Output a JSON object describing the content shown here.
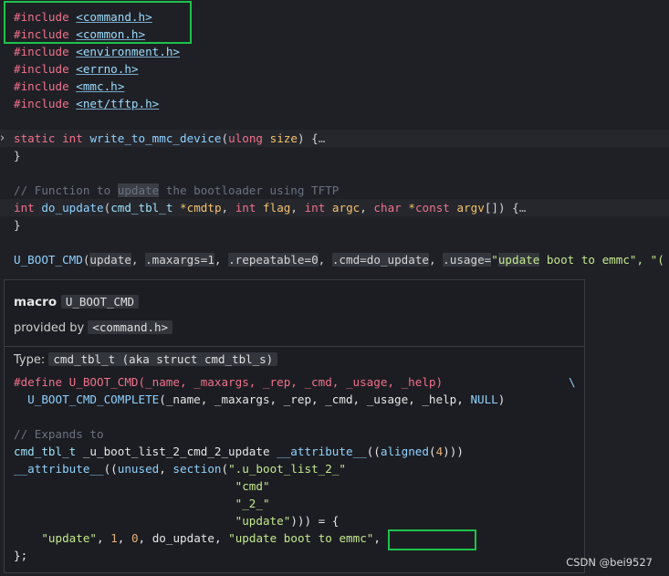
{
  "includes": [
    {
      "directive": "#include",
      "file": "<command.h>"
    },
    {
      "directive": "#include",
      "file": "<common.h>"
    },
    {
      "directive": "#include",
      "file": "<environment.h>"
    },
    {
      "directive": "#include",
      "file": "<errno.h>"
    },
    {
      "directive": "#include",
      "file": "<mmc.h>"
    },
    {
      "directive": "#include",
      "file": "<net/tftp.h>"
    }
  ],
  "write_fn": {
    "kw_static": "static",
    "kw_int": "int",
    "name": "write_to_mmc_device",
    "param_type": "ulong",
    "param": "size",
    "close": ") {",
    "ellipsis": "…",
    "brace": "}"
  },
  "comment": {
    "pre": "// Function to ",
    "hl": "update",
    "post": " the bootloader using TFTP"
  },
  "do_update_fn": {
    "ret": "int",
    "name": "do_update",
    "t1": "cmd_tbl_t",
    "p1": "*cmdtp",
    "t2": "int",
    "p2": "flag",
    "t3": "int",
    "p3": "argc",
    "t4": "char",
    "p4a": "*",
    "kw_const": "const",
    "p4": "argv",
    "tail": "[]) {",
    "ellipsis": "…",
    "brace": "}"
  },
  "uboot_cmd_line": {
    "macro": "U_BOOT_CMD",
    "a1": "update",
    "f1": ".maxargs=1",
    "f2": ".repeatable=0",
    "f3": ".cmd=do_update",
    "f4": ".usage=",
    "s1a": "\"",
    "s1b": "update",
    "s1c": " boot to emmc\"",
    "tail": ", \"("
  },
  "hover": {
    "kind": "macro",
    "name": "U_BOOT_CMD",
    "provided_label": "provided by",
    "provided_file": "<command.h>",
    "type_label": "Type:",
    "type_value": "cmd_tbl_t (aka struct cmd_tbl_s)",
    "def_line1": "#define U_BOOT_CMD(_name, _maxargs, _rep, _cmd, _usage, _help)",
    "def_backslash": "\\",
    "def_line2_macro": "U_BOOT_CMD_COMPLETE",
    "def_line2_args": "(_name, _maxargs, _rep, _cmd, _usage, _help, ",
    "def_line2_null": "NULL",
    "def_line2_end": ")",
    "expands_comment": "// Expands to",
    "exp1_type": "cmd_tbl_t",
    "exp1_var": " _u_boot_list_2_cmd_2_update ",
    "exp1_attr": "__attribute__",
    "exp1_open": "((",
    "exp1_aligned": "aligned",
    "exp1_num_open": "(",
    "exp1_num": "4",
    "exp1_close": ")))",
    "exp2_attr": "__attribute__",
    "exp2_open": "((",
    "exp2_unused": "unused",
    "exp2_sep": ", ",
    "exp2_section": "section",
    "exp2_paren": "(",
    "exp2_str": "\".u_boot_list_2_\"",
    "exp3_str": "\"cmd\"",
    "exp4_str": "\"_2_\"",
    "exp5_str": "\"update\"",
    "exp5_tail": "))) = {",
    "exp6_s1": "\"update\"",
    "exp6_n1": "1",
    "exp6_n2": "0",
    "exp6_fn": "do_update",
    "exp6_s2": "\"update boot to emmc\"",
    "exp6_comma": ",",
    "exp7": "};"
  },
  "watermark": "CSDN @bei9527"
}
